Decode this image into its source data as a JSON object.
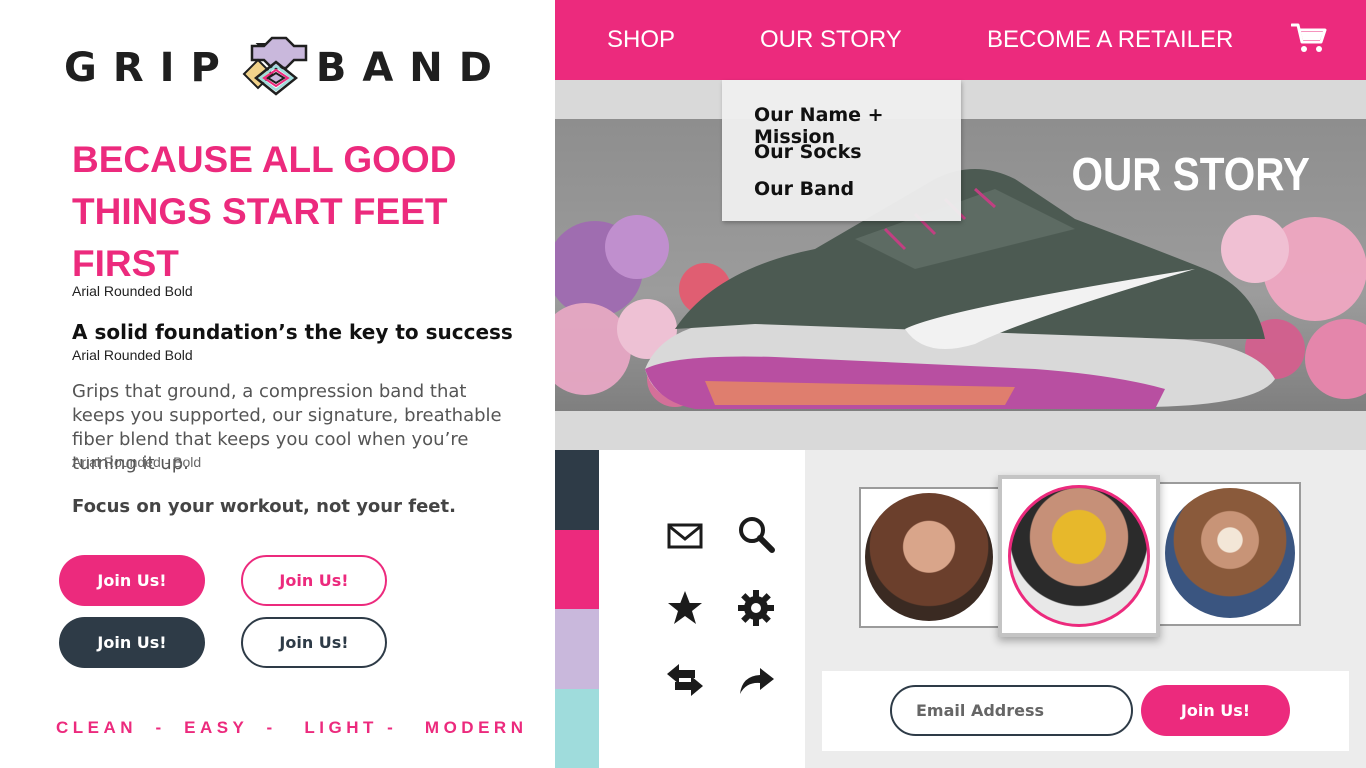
{
  "brand": {
    "word_left": "GRIP",
    "word_right": "BAND",
    "pink": "#ec2a7d",
    "navy": "#2e3b47",
    "lavender": "#c9b8dc",
    "aqua": "#9fdcdc"
  },
  "style_guide": {
    "headline": "BECAUSE ALL GOOD THINGS START FEET FIRST",
    "headline_note": "Arial Rounded Bold",
    "subhead": "A solid foundation’s the key to success",
    "subhead_note": "Arial Rounded Bold",
    "body": "Grips that ground, a compression band that keeps you supported, our signature, breathable fiber blend that keeps you cool when you’re turning it up.",
    "body_note": "Arial Rounded - Bold",
    "focus": "Focus on your workout, not your feet.",
    "buttons": [
      "Join Us!",
      "Join Us!",
      "Join Us!",
      "Join Us!"
    ],
    "tagline": "CLEAN  -  EASY  -   LIGHT -   MODERN"
  },
  "nav": {
    "shop": "SHOP",
    "our_story": "OUR STORY",
    "retailer": "BECOME A RETAILER",
    "cart_icon": "shopping-cart-icon"
  },
  "dropdown": {
    "items": [
      "Our Name + Mission",
      "Our Socks",
      "Our Band"
    ]
  },
  "hero": {
    "title": "OUR STORY"
  },
  "icons": [
    "mail-icon",
    "search-icon",
    "star-icon",
    "gear-icon",
    "swap-arrows-icon",
    "share-arrow-icon"
  ],
  "signup": {
    "email_placeholder": "Email Address",
    "join_label": "Join Us!"
  }
}
